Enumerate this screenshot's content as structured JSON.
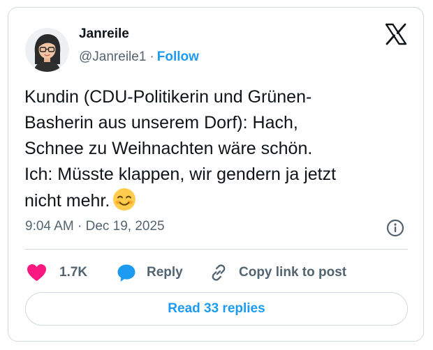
{
  "author": {
    "display_name": "Janreile",
    "handle": "@Janreile1",
    "separator": "·",
    "follow_label": "Follow"
  },
  "tweet": {
    "lines": [
      "Kundin (CDU-Politikerin und Grünen-",
      "Basherin aus unserem Dorf): Hach,",
      "Schnee zu Weihnachten wäre schön.",
      "Ich: Müsste klappen, wir gendern ja jetzt",
      "nicht mehr."
    ],
    "emoji": "smiling-face-with-smiling-eyes",
    "timestamp": "9:04 AM · Dec 19, 2025"
  },
  "actions": {
    "like_count": "1.7K",
    "reply_label": "Reply",
    "copy_link_label": "Copy link to post"
  },
  "read_replies_label": "Read 33 replies",
  "colors": {
    "accent": "#1d9bf0",
    "like": "#f91880",
    "text": "#0f1419",
    "secondary": "#536471",
    "border": "#cfd9de"
  },
  "icons": {
    "brand": "x-logo-icon",
    "info": "info-icon",
    "like": "heart-icon",
    "reply": "speech-bubble-icon",
    "copy": "link-icon"
  }
}
